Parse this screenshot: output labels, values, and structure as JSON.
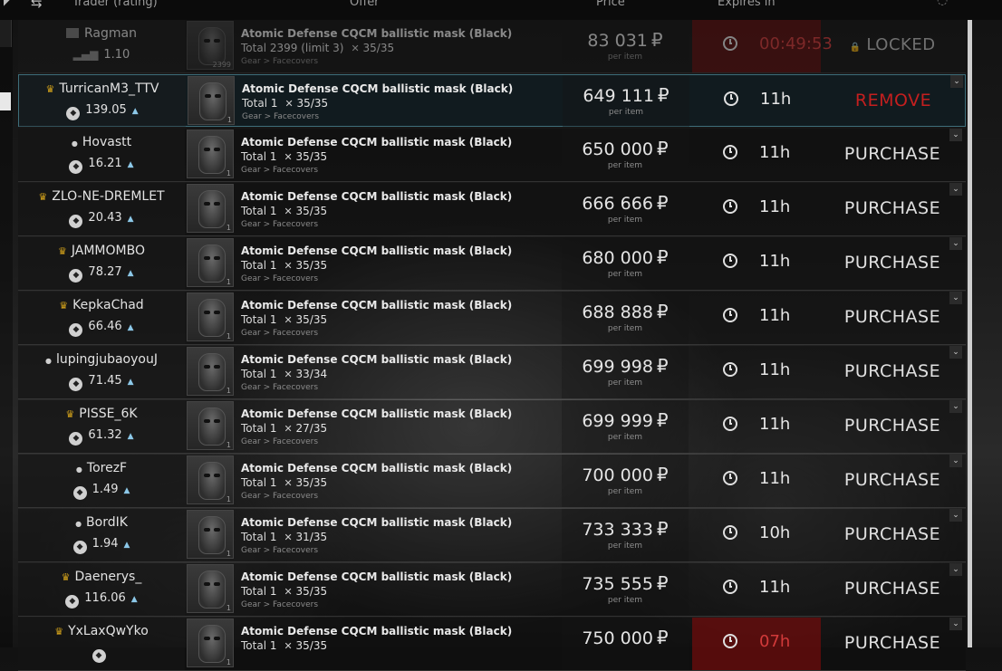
{
  "header": {
    "columns": [
      "Trader (rating)",
      "Offer",
      "Price ^",
      "Expires in"
    ]
  },
  "offers": [
    {
      "trader": "Ragman",
      "type": "trader",
      "rating": "1.10",
      "item": "Atomic Defense CQCM ballistic mask (Black)",
      "total_label": "Total",
      "total": "2399",
      "limit": "(limit 3)",
      "durability": "35/35",
      "category": "Gear > Facecovers",
      "qty": "2399",
      "price": "83 031",
      "per_item": "per item",
      "expires": "00:49:53",
      "urgent": true,
      "action": "LOCKED",
      "state": "locked"
    },
    {
      "trader": "TurricanM3_TTV",
      "type": "crown",
      "rating": "139.05",
      "item": "Atomic Defense CQCM ballistic mask (Black)",
      "total_label": "Total",
      "total": "1",
      "limit": "",
      "durability": "35/35",
      "category": "Gear > Facecovers",
      "qty": "1",
      "price": "649 111",
      "per_item": "per item",
      "expires": "11h",
      "urgent": false,
      "action": "REMOVE",
      "state": "own"
    },
    {
      "trader": "Hovastt",
      "type": "person",
      "rating": "16.21",
      "item": "Atomic Defense CQCM ballistic mask (Black)",
      "total_label": "Total",
      "total": "1",
      "limit": "",
      "durability": "35/35",
      "category": "Gear > Facecovers",
      "qty": "1",
      "price": "650 000",
      "per_item": "per item",
      "expires": "11h",
      "urgent": false,
      "action": "PURCHASE",
      "state": "normal"
    },
    {
      "trader": "ZLO-NE-DREMLET",
      "type": "crown",
      "rating": "20.43",
      "item": "Atomic Defense CQCM ballistic mask (Black)",
      "total_label": "Total",
      "total": "1",
      "limit": "",
      "durability": "35/35",
      "category": "Gear > Facecovers",
      "qty": "1",
      "price": "666 666",
      "per_item": "per item",
      "expires": "11h",
      "urgent": false,
      "action": "PURCHASE",
      "state": "normal"
    },
    {
      "trader": "JAMMOMBO",
      "type": "crown",
      "rating": "78.27",
      "item": "Atomic Defense CQCM ballistic mask (Black)",
      "total_label": "Total",
      "total": "1",
      "limit": "",
      "durability": "35/35",
      "category": "Gear > Facecovers",
      "qty": "1",
      "price": "680 000",
      "per_item": "per item",
      "expires": "11h",
      "urgent": false,
      "action": "PURCHASE",
      "state": "normal"
    },
    {
      "trader": "KepkaChad",
      "type": "crown",
      "rating": "66.46",
      "item": "Atomic Defense CQCM ballistic mask (Black)",
      "total_label": "Total",
      "total": "1",
      "limit": "",
      "durability": "35/35",
      "category": "Gear > Facecovers",
      "qty": "1",
      "price": "688 888",
      "per_item": "per item",
      "expires": "11h",
      "urgent": false,
      "action": "PURCHASE",
      "state": "normal"
    },
    {
      "trader": "lupingjubaoyouJ",
      "type": "person",
      "rating": "71.45",
      "item": "Atomic Defense CQCM ballistic mask (Black)",
      "total_label": "Total",
      "total": "1",
      "limit": "",
      "durability": "33/34",
      "category": "Gear > Facecovers",
      "qty": "1",
      "price": "699 998",
      "per_item": "per item",
      "expires": "11h",
      "urgent": false,
      "action": "PURCHASE",
      "state": "normal"
    },
    {
      "trader": "PISSE_6K",
      "type": "crown",
      "rating": "61.32",
      "item": "Atomic Defense CQCM ballistic mask (Black)",
      "total_label": "Total",
      "total": "1",
      "limit": "",
      "durability": "27/35",
      "category": "Gear > Facecovers",
      "qty": "1",
      "price": "699 999",
      "per_item": "per item",
      "expires": "11h",
      "urgent": false,
      "action": "PURCHASE",
      "state": "normal"
    },
    {
      "trader": "TorezF",
      "type": "person",
      "rating": "1.49",
      "item": "Atomic Defense CQCM ballistic mask (Black)",
      "total_label": "Total",
      "total": "1",
      "limit": "",
      "durability": "35/35",
      "category": "Gear > Facecovers",
      "qty": "1",
      "price": "700 000",
      "per_item": "per item",
      "expires": "11h",
      "urgent": false,
      "action": "PURCHASE",
      "state": "normal"
    },
    {
      "trader": "BordIK",
      "type": "person",
      "rating": "1.94",
      "item": "Atomic Defense CQCM ballistic mask (Black)",
      "total_label": "Total",
      "total": "1",
      "limit": "",
      "durability": "31/35",
      "category": "Gear > Facecovers",
      "qty": "1",
      "price": "733 333",
      "per_item": "per item",
      "expires": "10h",
      "urgent": false,
      "action": "PURCHASE",
      "state": "normal"
    },
    {
      "trader": "Daenerys_",
      "type": "crown",
      "rating": "116.06",
      "item": "Atomic Defense CQCM ballistic mask (Black)",
      "total_label": "Total",
      "total": "1",
      "limit": "",
      "durability": "35/35",
      "category": "Gear > Facecovers",
      "qty": "1",
      "price": "735 555",
      "per_item": "per item",
      "expires": "11h",
      "urgent": false,
      "action": "PURCHASE",
      "state": "normal"
    },
    {
      "trader": "YxLaxQwYko",
      "type": "crown",
      "rating": "",
      "item": "Atomic Defense CQCM ballistic mask (Black)",
      "total_label": "Total",
      "total": "1",
      "limit": "",
      "durability": "35/35",
      "category": "",
      "qty": "1",
      "price": "750 000",
      "per_item": "",
      "expires": "07h",
      "urgent": true,
      "action": "PURCHASE",
      "state": "normal"
    }
  ],
  "currency_symbol": "₽",
  "colors": {
    "remove": "#c41f1f",
    "urgent_bg": "#6e0c0c",
    "own_border": "#3e6e7a",
    "crown": "#d7a51b"
  }
}
